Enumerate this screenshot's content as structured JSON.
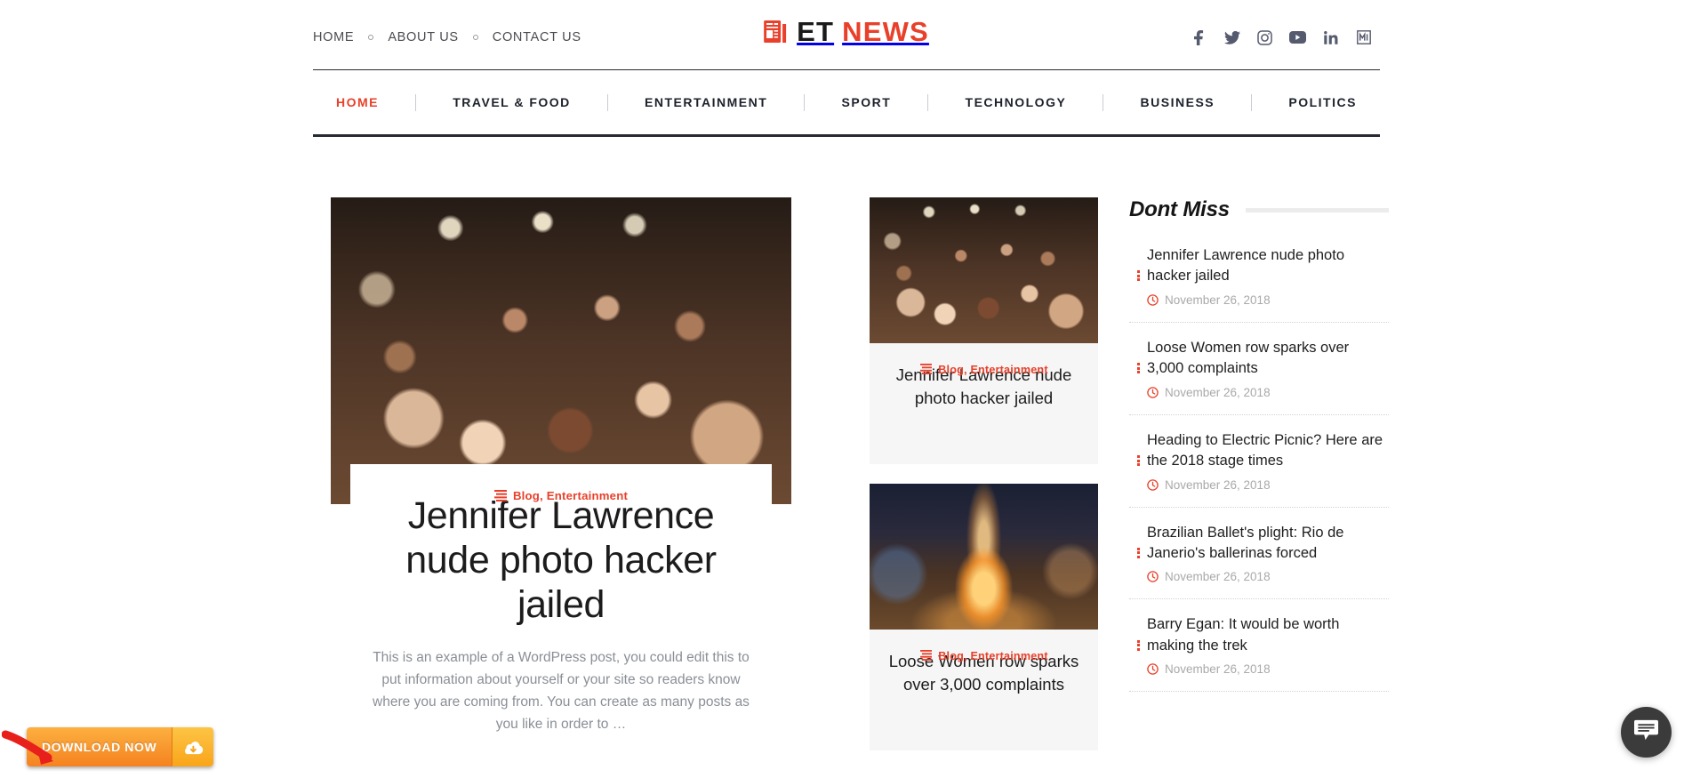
{
  "site": {
    "logo_icon": "newspaper-icon",
    "logo_part1": "ET",
    "logo_part2": "NEWS"
  },
  "topbar": {
    "links": [
      {
        "label": "HOME"
      },
      {
        "label": "ABOUT US"
      },
      {
        "label": "CONTACT US"
      }
    ],
    "socials": [
      {
        "name": "facebook-icon"
      },
      {
        "name": "twitter-icon"
      },
      {
        "name": "instagram-icon"
      },
      {
        "name": "youtube-icon"
      },
      {
        "name": "linkedin-icon"
      },
      {
        "name": "medium-icon"
      }
    ]
  },
  "nav": {
    "items": [
      {
        "label": "HOME",
        "active": true
      },
      {
        "label": "TRAVEL & FOOD",
        "active": false
      },
      {
        "label": "ENTERTAINMENT",
        "active": false
      },
      {
        "label": "SPORT",
        "active": false
      },
      {
        "label": "TECHNOLOGY",
        "active": false
      },
      {
        "label": "BUSINESS",
        "active": false
      },
      {
        "label": "POLITICS",
        "active": false
      }
    ]
  },
  "feature": {
    "image_alt": "concert-crowd-photo",
    "categories": "Blog, Entertainment",
    "title": "Jennifer Lawrence nude photo hacker jailed",
    "excerpt": "This is an example of a WordPress post, you could edit this to put information about yourself or your site so readers know where you are coming from. You can create as many posts as you like in order to …"
  },
  "mid_cards": [
    {
      "image_alt": "concert-crowd-photo",
      "categories": "Blog, Entertainment",
      "title": "Jennifer Lawrence nude photo hacker jailed"
    },
    {
      "image_alt": "bonfire-night-photo",
      "categories": "Blog, Entertainment",
      "title": "Loose Women row sparks over 3,000 complaints"
    }
  ],
  "sidebar": {
    "title": "Dont Miss",
    "items": [
      {
        "title": "Jennifer Lawrence nude photo hacker jailed",
        "date": "November 26, 2018"
      },
      {
        "title": "Loose Women row sparks over 3,000 complaints",
        "date": "November 26, 2018"
      },
      {
        "title": "Heading to Electric Picnic? Here are the 2018 stage times",
        "date": "November 26, 2018"
      },
      {
        "title": "Brazilian Ballet's plight: Rio de Janerio's ballerinas forced",
        "date": "November 26, 2018"
      },
      {
        "title": "Barry Egan: It would be worth making the trek",
        "date": "November 26, 2018"
      }
    ]
  },
  "download": {
    "label": "DOWNLOAD NOW",
    "icon": "cloud-download-icon",
    "arrow": "red-curved-arrow-icon"
  },
  "chat": {
    "icon": "chat-bubble-icon"
  },
  "colors": {
    "accent": "#e8402a",
    "nav_text": "#1c212b",
    "muted": "#8a8f96",
    "download_orange": "#f58220",
    "chat_dark": "#3b3b3b"
  }
}
